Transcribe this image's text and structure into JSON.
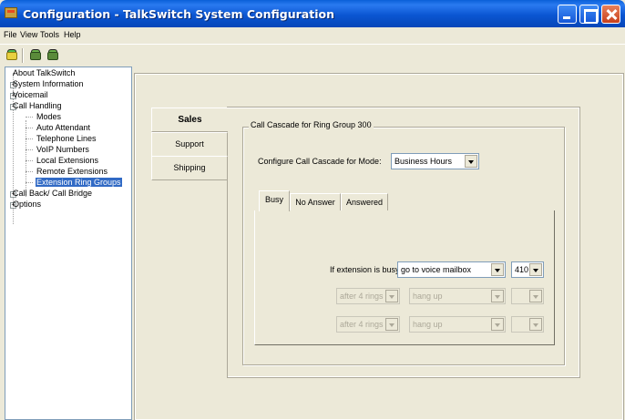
{
  "window": {
    "title": "Configuration - TalkSwitch System Configuration"
  },
  "menu": [
    {
      "label": "File"
    },
    {
      "label": "View"
    },
    {
      "label": "Tools"
    },
    {
      "label": "Help"
    }
  ],
  "tree": {
    "items": [
      {
        "label": "About TalkSwitch",
        "level": 0,
        "expander": ""
      },
      {
        "label": "System Information",
        "level": 0,
        "expander": "+"
      },
      {
        "label": "Voicemail",
        "level": 0,
        "expander": "+"
      },
      {
        "label": "Call Handling",
        "level": 0,
        "expander": "-"
      },
      {
        "label": "Modes",
        "level": 1,
        "expander": ""
      },
      {
        "label": "Auto Attendant",
        "level": 1,
        "expander": ""
      },
      {
        "label": "Telephone Lines",
        "level": 1,
        "expander": ""
      },
      {
        "label": "VoIP Numbers",
        "level": 1,
        "expander": ""
      },
      {
        "label": "Local Extensions",
        "level": 1,
        "expander": ""
      },
      {
        "label": "Remote Extensions",
        "level": 1,
        "expander": ""
      },
      {
        "label": "Extension Ring Groups",
        "level": 1,
        "expander": "",
        "selected": true
      },
      {
        "label": "Call Back/ Call Bridge",
        "level": 0,
        "expander": "+"
      },
      {
        "label": "Options",
        "level": 0,
        "expander": "+"
      }
    ]
  },
  "side_tabs": [
    {
      "label": "Sales",
      "active": true
    },
    {
      "label": "Support",
      "active": false
    },
    {
      "label": "Shipping",
      "active": false
    }
  ],
  "cascade": {
    "group_title": "Call Cascade for Ring Group 300",
    "mode_label": "Configure Call Cascade for Mode:",
    "mode_value": "Business Hours",
    "tabs": [
      {
        "label": "Busy",
        "active": true
      },
      {
        "label": "No Answer",
        "active": false
      },
      {
        "label": "Answered",
        "active": false
      }
    ],
    "busy_label": "If extension is busy:",
    "busy_action": "go to voice mailbox",
    "busy_mailbox": "410",
    "disabled_rows": [
      {
        "delay": "after 4 rings",
        "action": "hang up",
        "target": ""
      },
      {
        "delay": "after 4 rings",
        "action": "hang up",
        "target": ""
      }
    ]
  },
  "colors": {
    "titlebar": "#0b56d2",
    "window_bg": "#ece9d8",
    "selection": "#316ac5"
  }
}
